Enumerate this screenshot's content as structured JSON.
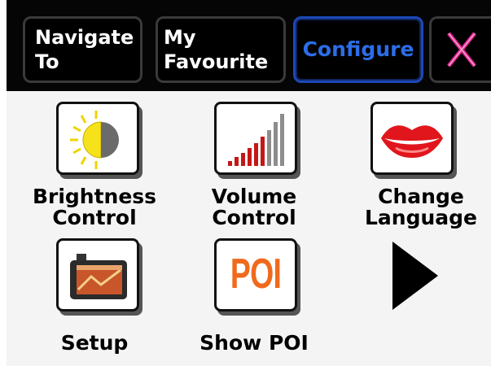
{
  "tabs": {
    "navigate": [
      "Navigate",
      "To"
    ],
    "favourite": [
      "My",
      "Favourite"
    ],
    "configure": "Configure"
  },
  "items": [
    {
      "lines": [
        "Brightness",
        "Control"
      ],
      "icon": "brightness-icon"
    },
    {
      "lines": [
        "Volume",
        "Control"
      ],
      "icon": "volume-icon"
    },
    {
      "lines": [
        "Change",
        "Language"
      ],
      "icon": "lips-icon"
    },
    {
      "lines": [
        "Setup"
      ],
      "icon": "gps-device-icon"
    },
    {
      "lines": [
        "Show POI"
      ],
      "icon": "poi-icon",
      "icon_text": "POI"
    }
  ],
  "colors": {
    "configure_accent": "#2c6de8",
    "close_x": "#e0208a",
    "volume_bar": "#c41818",
    "poi_orange": "#f06a1c"
  },
  "next_arrow_icon": "play-arrow-icon"
}
